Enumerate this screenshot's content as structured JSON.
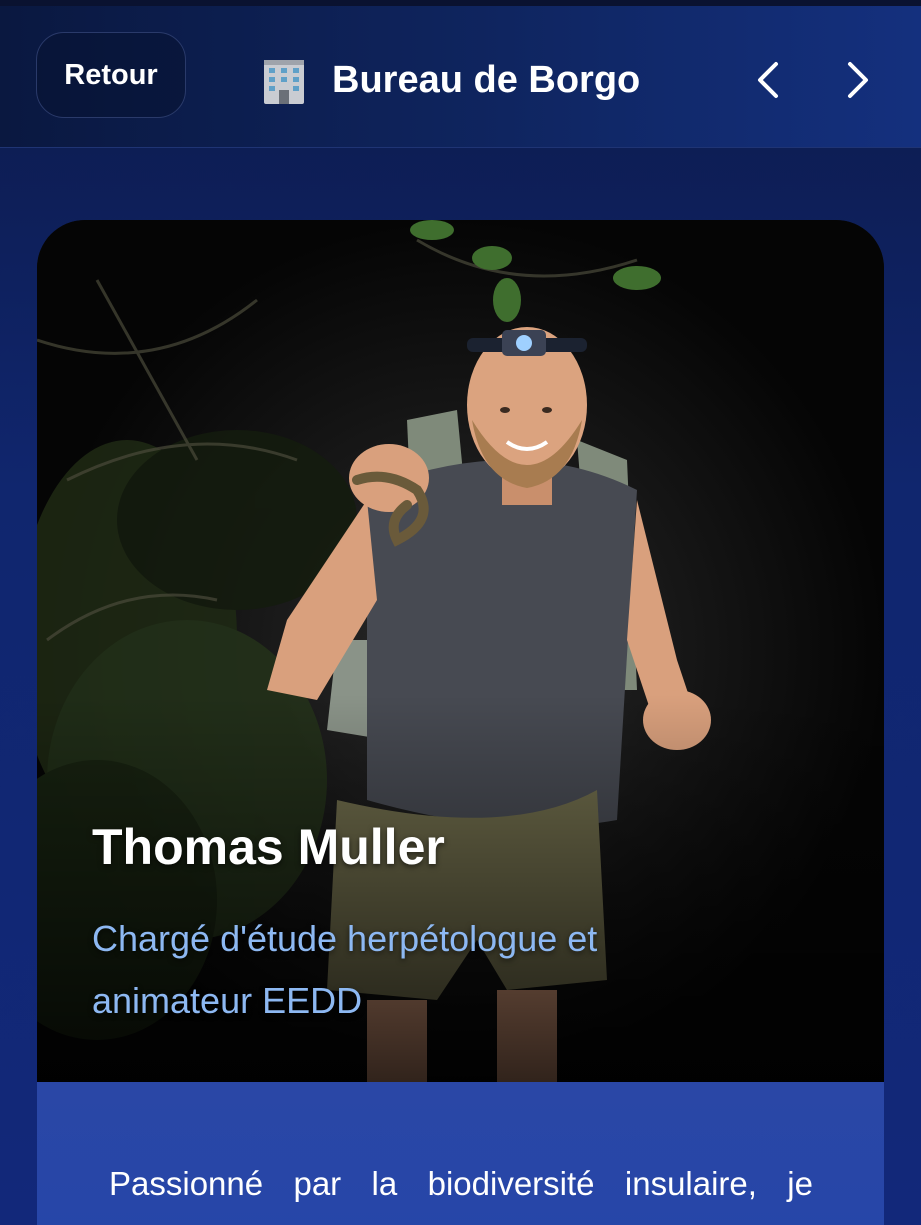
{
  "header": {
    "back_label": "Retour",
    "title": "Bureau de Borgo",
    "title_icon": "office-building-icon",
    "prev_icon": "chevron-left-icon",
    "next_icon": "chevron-right-icon"
  },
  "profile": {
    "name": "Thomas Muller",
    "role": "Chargé d'étude herpétologue et animateur EEDD",
    "bio": "Passionné par la biodiversité insulaire, je"
  },
  "colors": {
    "background": "#10266e",
    "role_text": "#8db8f2",
    "bio_panel": "#2a47a6"
  }
}
